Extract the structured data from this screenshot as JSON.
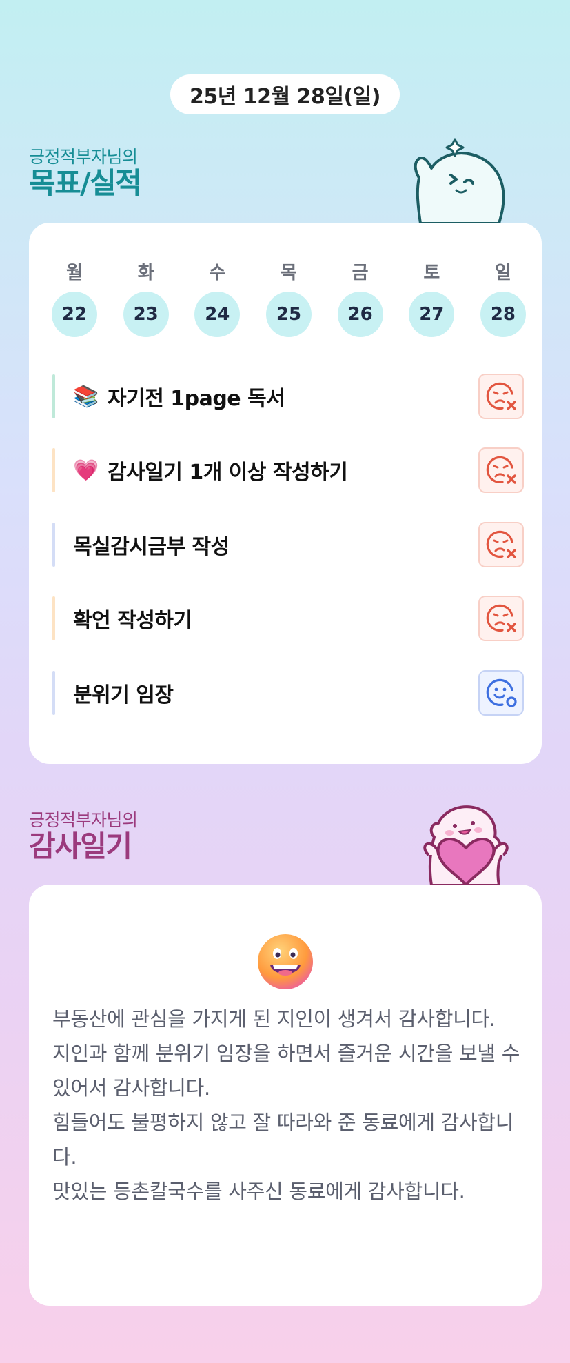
{
  "date": "25년 12월 28일(일)",
  "goal_section": {
    "subtitle": "긍정적부자님의",
    "title": "목표/실적"
  },
  "week": {
    "days": [
      {
        "label": "월",
        "num": "22"
      },
      {
        "label": "화",
        "num": "23"
      },
      {
        "label": "수",
        "num": "24"
      },
      {
        "label": "목",
        "num": "25"
      },
      {
        "label": "금",
        "num": "26"
      },
      {
        "label": "토",
        "num": "27"
      },
      {
        "label": "일",
        "num": "28"
      }
    ]
  },
  "goals": [
    {
      "text": "자기전 1page 독서",
      "icon": "books-icon",
      "icon_glyph": "📚",
      "bar_color": "#bfe9d9",
      "status": "fail"
    },
    {
      "text": "감사일기 1개 이상 작성하기",
      "icon": "heart-icon",
      "icon_glyph": "💗",
      "bar_color": "#fde3c4",
      "status": "fail"
    },
    {
      "text": "목실감시금부 작성",
      "icon": "",
      "icon_glyph": "",
      "bar_color": "#d4ddf6",
      "status": "fail"
    },
    {
      "text": "확언 작성하기",
      "icon": "",
      "icon_glyph": "",
      "bar_color": "#fde3c4",
      "status": "fail"
    },
    {
      "text": "분위기 임장",
      "icon": "",
      "icon_glyph": "",
      "bar_color": "#d4ddf6",
      "status": "success"
    }
  ],
  "thanks_section": {
    "subtitle": "긍정적부자님의",
    "title": "감사일기"
  },
  "diary": {
    "emoji": "grinning-face-icon",
    "lines": [
      "부동산에 관심을 가지게 된 지인이 생겨서 감사합니다.",
      "지인과 함께 분위기 임장을 하면서 즐거운 시간을 보낼 수 있어서 감사합니다.",
      "힘들어도 불평하지 않고 잘 따라와 준 동료에게 감사합니다.",
      "맛있는 등촌칼국수를 사주신 동료에게 감사합니다."
    ]
  },
  "colors": {
    "goal_accent": "#168d95",
    "thanks_accent": "#9b3a7d",
    "fail": "#e2553f",
    "success": "#3d6fe0",
    "day_circle": "#c8f1f3"
  }
}
